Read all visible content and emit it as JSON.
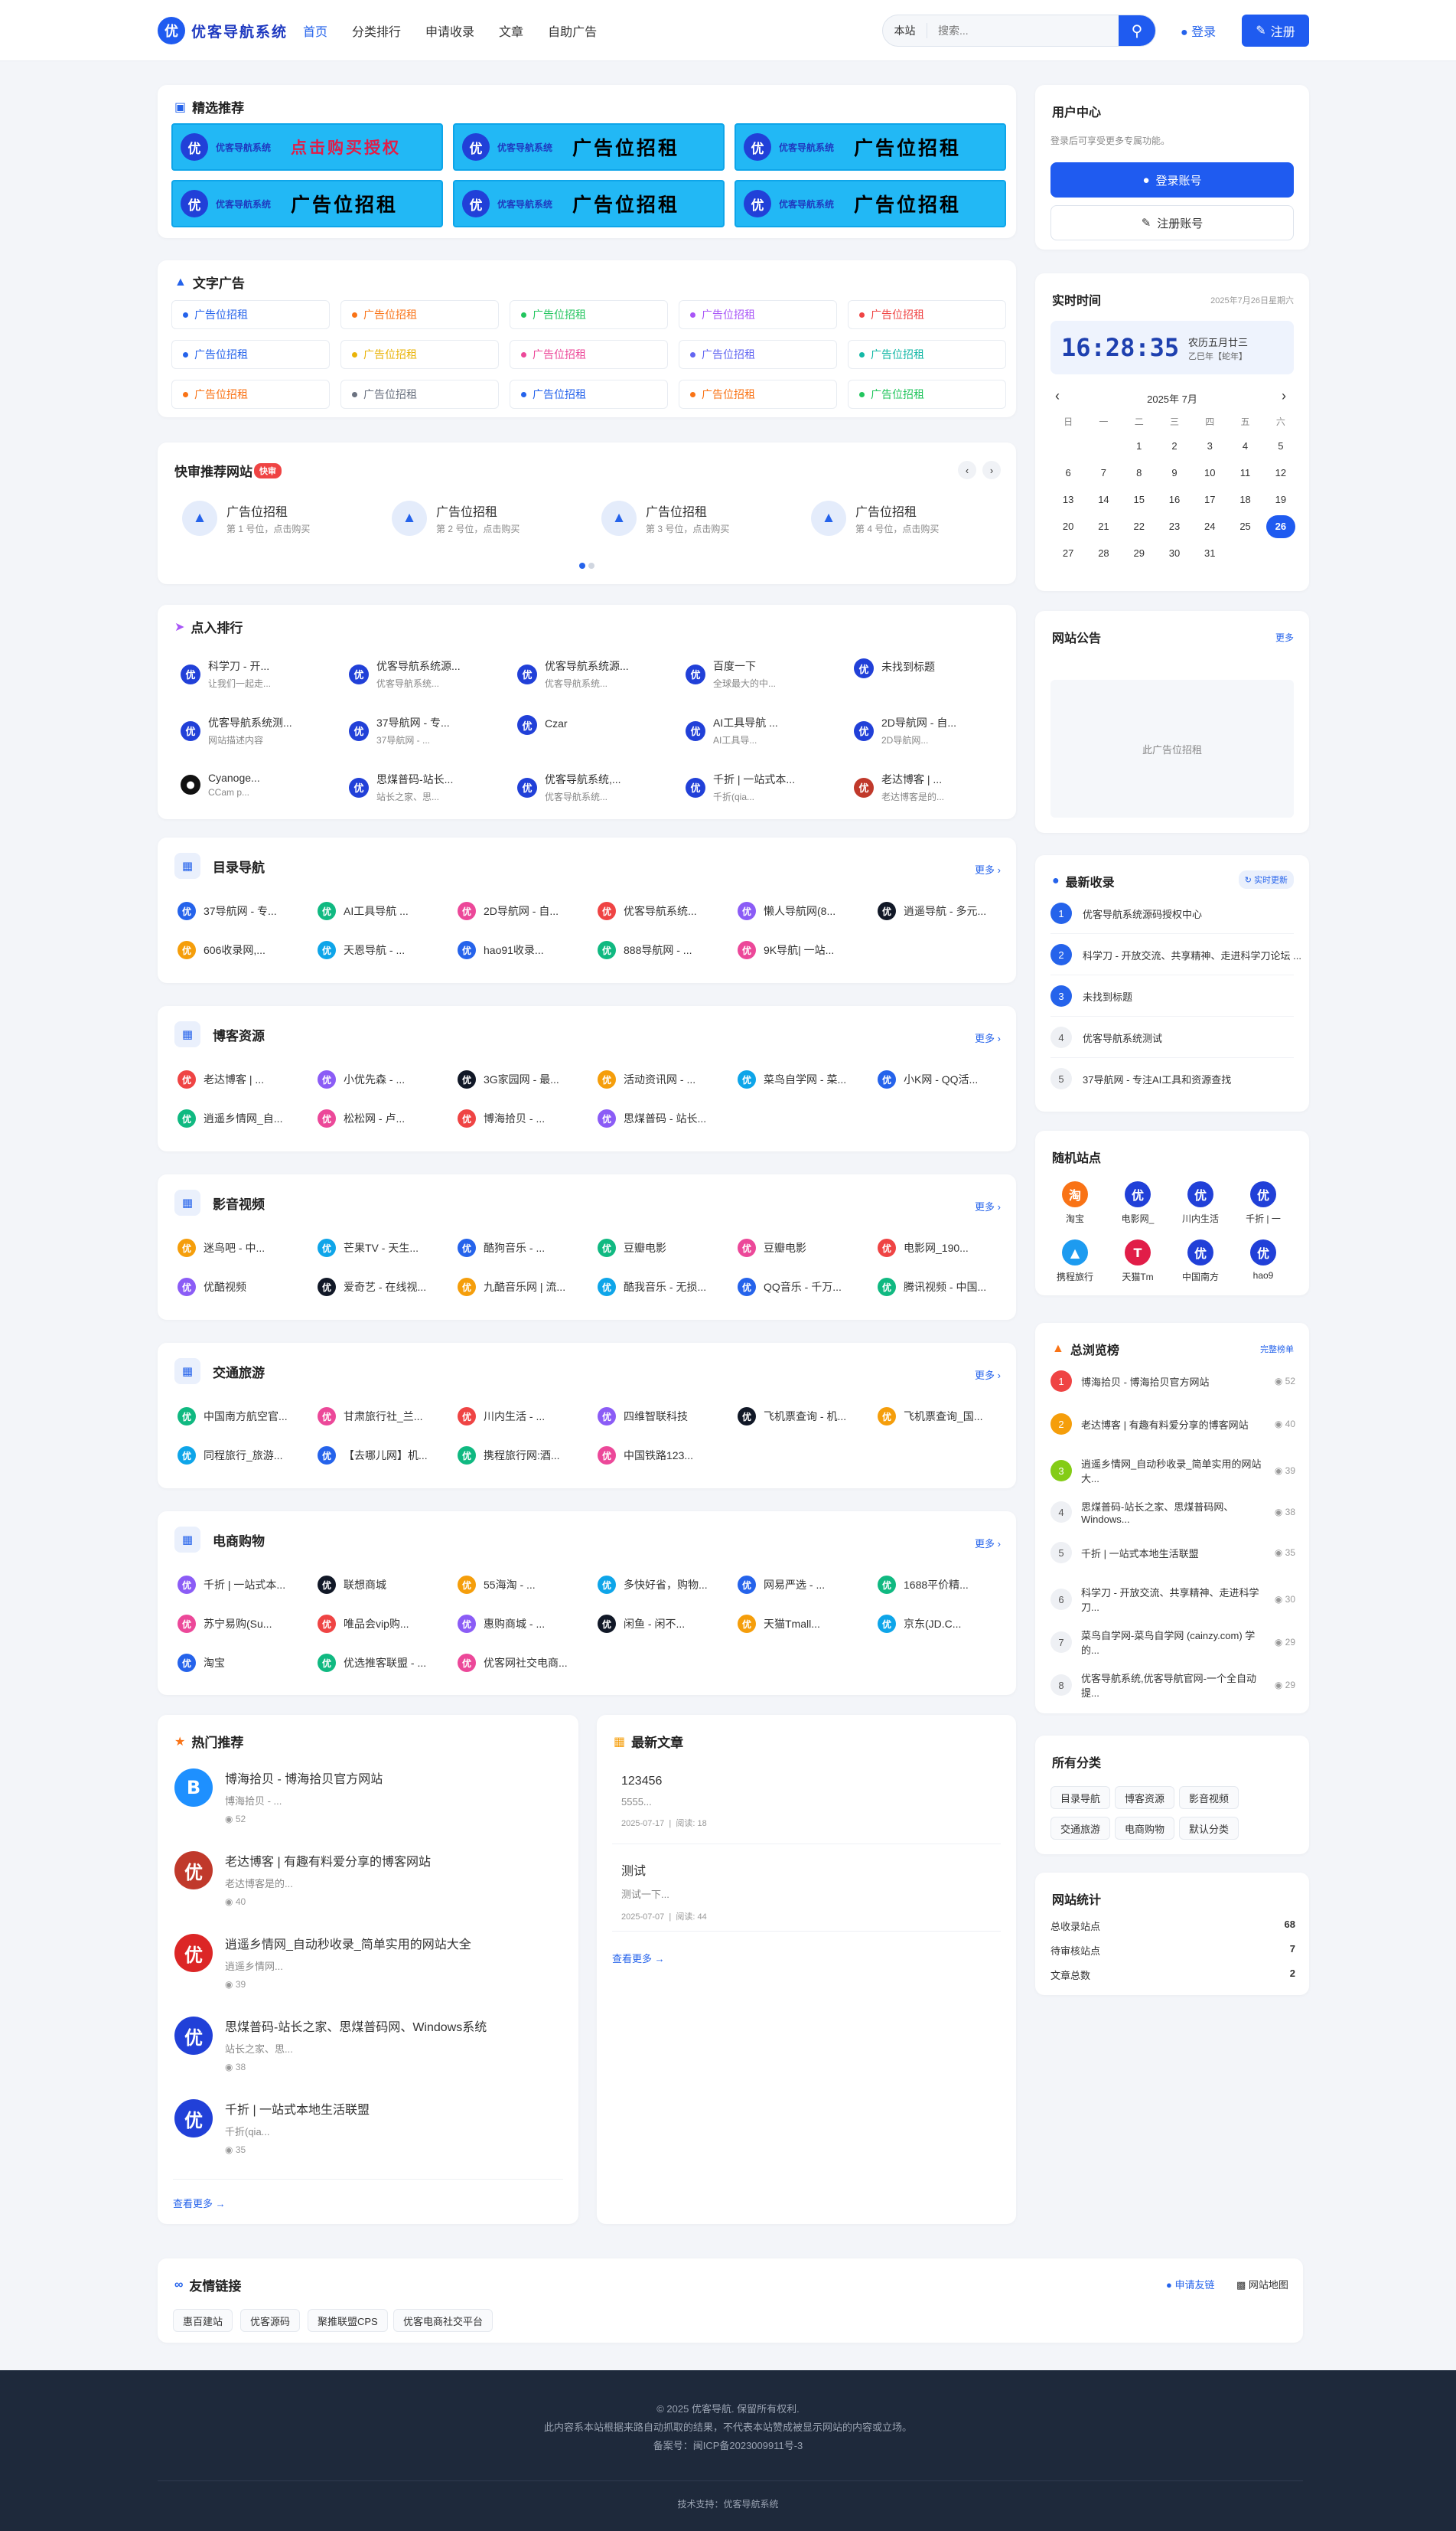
{
  "header": {
    "logo_char": "优",
    "logo_text": "优客导航系统",
    "nav": [
      "首页",
      "分类排行",
      "申请收录",
      "文章",
      "自助广告"
    ],
    "search_scope": "本站",
    "search_placeholder": "搜索...",
    "login": "登录",
    "register": "注册"
  },
  "featured": {
    "title": "精选推荐",
    "banner_brand": "优客导航系统",
    "banners": [
      "点击购买授权",
      "广告位招租",
      "广告位招租",
      "广告位招租",
      "广告位招租",
      "广告位招租"
    ]
  },
  "text_ads": {
    "title": "文字广告",
    "items": [
      "广告位招租",
      "广告位招租",
      "广告位招租",
      "广告位招租",
      "广告位招租",
      "广告位招租",
      "广告位招租",
      "广告位招租",
      "广告位招租",
      "广告位招租",
      "广告位招租",
      "广告位招租",
      "广告位招租",
      "广告位招租",
      "广告位招租"
    ],
    "colors": [
      "#2563eb",
      "#f97316",
      "#22c55e",
      "#a855f7",
      "#ef4444",
      "#2563eb",
      "#eab308",
      "#ec4899",
      "#6366f1",
      "#14b8a6",
      "#f97316",
      "#6b7280",
      "#2563eb",
      "#f97316",
      "#22c55e"
    ]
  },
  "quick": {
    "title": "快审推荐网站",
    "badge": "快审",
    "items": [
      {
        "t": "广告位招租",
        "s": "第 1 号位，点击购买"
      },
      {
        "t": "广告位招租",
        "s": "第 2 号位，点击购买"
      },
      {
        "t": "广告位招租",
        "s": "第 3 号位，点击购买"
      },
      {
        "t": "广告位招租",
        "s": "第 4 号位，点击购买"
      }
    ]
  },
  "ranking": {
    "title": "点入排行",
    "items": [
      {
        "t": "科学刀 - 开...",
        "s": "让我们一起走..."
      },
      {
        "t": "优客导航系统源...",
        "s": "优客导航系统..."
      },
      {
        "t": "优客导航系统源...",
        "s": "优客导航系统..."
      },
      {
        "t": "百度一下",
        "s": "全球最大的中..."
      },
      {
        "t": "未找到标题",
        "s": ""
      },
      {
        "t": "优客导航系统测...",
        "s": "网站描述内容"
      },
      {
        "t": "37导航网 - 专...",
        "s": "37导航网 - ..."
      },
      {
        "t": "Czar",
        "s": ""
      },
      {
        "t": "AI工具导航 ...",
        "s": "AI工具导..."
      },
      {
        "t": "2D导航网 - 自...",
        "s": "2D导航网..."
      },
      {
        "t": "Cyanoge...",
        "s": "CCam p..."
      },
      {
        "t": "思煤普码-站长...",
        "s": "站长之家、思..."
      },
      {
        "t": "优客导航系统,...",
        "s": "优客导航系统..."
      },
      {
        "t": "千折 | 一站式本...",
        "s": "千折(qia..."
      },
      {
        "t": "老达博客 | ...",
        "s": "老达博客是的..."
      }
    ]
  },
  "categories": [
    {
      "title": "目录导航",
      "more": "更多",
      "items": [
        "37导航网 - 专...",
        "AI工具导航 ...",
        "2D导航网 - 自...",
        "优客导航系统...",
        "懒人导航网(8...",
        "逍遥导航 - 多元...",
        "606收录网,...",
        "天恩导航 - ...",
        "hao91收录...",
        "888导航网 - ...",
        "9K导航| 一站..."
      ]
    },
    {
      "title": "博客资源",
      "more": "更多",
      "items": [
        "老达博客 | ...",
        "小优先森 - ...",
        "3G家园网 - 最...",
        "活动资讯网 - ...",
        "菜鸟自学网 - 菜...",
        "小K网 - QQ活...",
        "逍遥乡情网_自...",
        "松松网 - 卢...",
        "博海拾贝 - ...",
        "思煤普码 - 站长..."
      ]
    },
    {
      "title": "影音视频",
      "more": "更多",
      "items": [
        "迷鸟吧 - 中...",
        "芒果TV - 天生...",
        "酷狗音乐 - ...",
        "豆瓣电影",
        "豆瓣电影",
        "电影网_190...",
        "优酷视频",
        "爱奇艺 - 在线视...",
        "九酷音乐网 | 流...",
        "酷我音乐 - 无损...",
        "QQ音乐 - 千万...",
        "腾讯视频 - 中国..."
      ]
    },
    {
      "title": "交通旅游",
      "more": "更多",
      "items": [
        "中国南方航空官...",
        "甘肃旅行社_兰...",
        "川内生活 - ...",
        "四维智联科技",
        "飞机票查询 - 机...",
        "飞机票查询_国...",
        "同程旅行_旅游...",
        "【去哪儿网】机...",
        "携程旅行网:酒...",
        "中国铁路123..."
      ]
    },
    {
      "title": "电商购物",
      "more": "更多",
      "items": [
        "千折 | 一站式本...",
        "联想商城",
        "55海淘 - ...",
        "多快好省，购物...",
        "网易严选 - ...",
        "1688平价精...",
        "苏宁易购(Su...",
        "唯品会vip购...",
        "惠购商城 - ...",
        "闲鱼 - 闲不...",
        "天猫Tmall...",
        "京东(JD.C...",
        "淘宝",
        "优选推客联盟 - ...",
        "优客网社交电商..."
      ]
    }
  ],
  "hot": {
    "title": "热门推荐",
    "more": "查看更多",
    "items": [
      {
        "t": "博海拾贝 - 博海拾贝官方网站",
        "s": "博海拾贝 - ...",
        "v": "52"
      },
      {
        "t": "老达博客 | 有趣有料爱分享的博客网站",
        "s": "老达博客是的...",
        "v": "40"
      },
      {
        "t": "逍遥乡情网_自动秒收录_简单实用的网站大全",
        "s": "逍遥乡情网...",
        "v": "39"
      },
      {
        "t": "思煤普码-站长之家、思煤普码网、Windows系统",
        "s": "站长之家、思...",
        "v": "38"
      },
      {
        "t": "千折 | 一站式本地生活联盟",
        "s": "千折(qia...",
        "v": "35"
      }
    ]
  },
  "articles": {
    "title": "最新文章",
    "more": "查看更多",
    "items": [
      {
        "t": "123456",
        "s": "5555...",
        "d": "2025-07-17",
        "v": "阅读: 18"
      },
      {
        "t": "测试",
        "s": "测试一下...",
        "d": "2025-07-07",
        "v": "阅读: 44"
      }
    ]
  },
  "links": {
    "title": "友情链接",
    "apply": "申请友链",
    "sitemap": "网站地图",
    "items": [
      "惠百建站",
      "优客源码",
      "聚推联盟CPS",
      "优客电商社交平台"
    ]
  },
  "user": {
    "title": "用户中心",
    "desc": "登录后可享受更多专属功能。",
    "login": "登录账号",
    "register": "注册账号"
  },
  "clock": {
    "title": "实时时间",
    "date": "2025年7月26日星期六",
    "time": "16:28:35",
    "lunar": "农历五月廿三",
    "ganzhi": "乙巳年【蛇年】",
    "month": "2025年 7月",
    "weekdays": [
      "日",
      "一",
      "二",
      "三",
      "四",
      "五",
      "六"
    ],
    "today": "26"
  },
  "notice": {
    "title": "网站公告",
    "more": "更多",
    "ad": "此广告位招租"
  },
  "latest": {
    "title": "最新收录",
    "badge": "实时更新",
    "items": [
      "优客导航系统源码授权中心",
      "科学刀 - 开放交流、共享精神、走进科学刀论坛 ...",
      "未找到标题",
      "优客导航系统测试",
      "37导航网 - 专注AI工具和资源查找"
    ]
  },
  "random": {
    "title": "随机站点",
    "items": [
      "淘宝",
      "电影网_",
      "川内生活",
      "千折 | 一",
      "携程旅行",
      "天猫Tm",
      "中国南方",
      "hao9"
    ]
  },
  "views": {
    "title": "总浏览榜",
    "more": "完整榜单",
    "items": [
      {
        "t": "博海拾贝 - 博海拾贝官方网站",
        "v": "52"
      },
      {
        "t": "老达博客 | 有趣有料爱分享的博客网站",
        "v": "40"
      },
      {
        "t": "逍遥乡情网_自动秒收录_简单实用的网站大...",
        "v": "39"
      },
      {
        "t": "思煤普码-站长之家、思煤普码网、Windows...",
        "v": "38"
      },
      {
        "t": "千折 | 一站式本地生活联盟",
        "v": "35"
      },
      {
        "t": "科学刀 - 开放交流、共享精神、走进科学刀...",
        "v": "30"
      },
      {
        "t": "菜鸟自学网-菜鸟自学网 (cainzy.com) 学的...",
        "v": "29"
      },
      {
        "t": "优客导航系统,优客导航官网-一个全自动提...",
        "v": "29"
      }
    ]
  },
  "allcats": {
    "title": "所有分类",
    "items": [
      "目录导航",
      "博客资源",
      "影音视频",
      "交通旅游",
      "电商购物",
      "默认分类"
    ]
  },
  "stats": {
    "title": "网站统计",
    "items": [
      {
        "k": "总收录站点",
        "v": "68"
      },
      {
        "k": "待审核站点",
        "v": "7"
      },
      {
        "k": "文章总数",
        "v": "2"
      }
    ]
  },
  "footer": {
    "copy": "© 2025 优客导航. 保留所有权利.",
    "disclaimer": "此内容系本站根据来路自动抓取的结果，不代表本站赞成被显示网站的内容或立场。",
    "icp": "备案号：闽ICP备2023009911号-3",
    "tech": "技术支持：优客导航系统"
  }
}
